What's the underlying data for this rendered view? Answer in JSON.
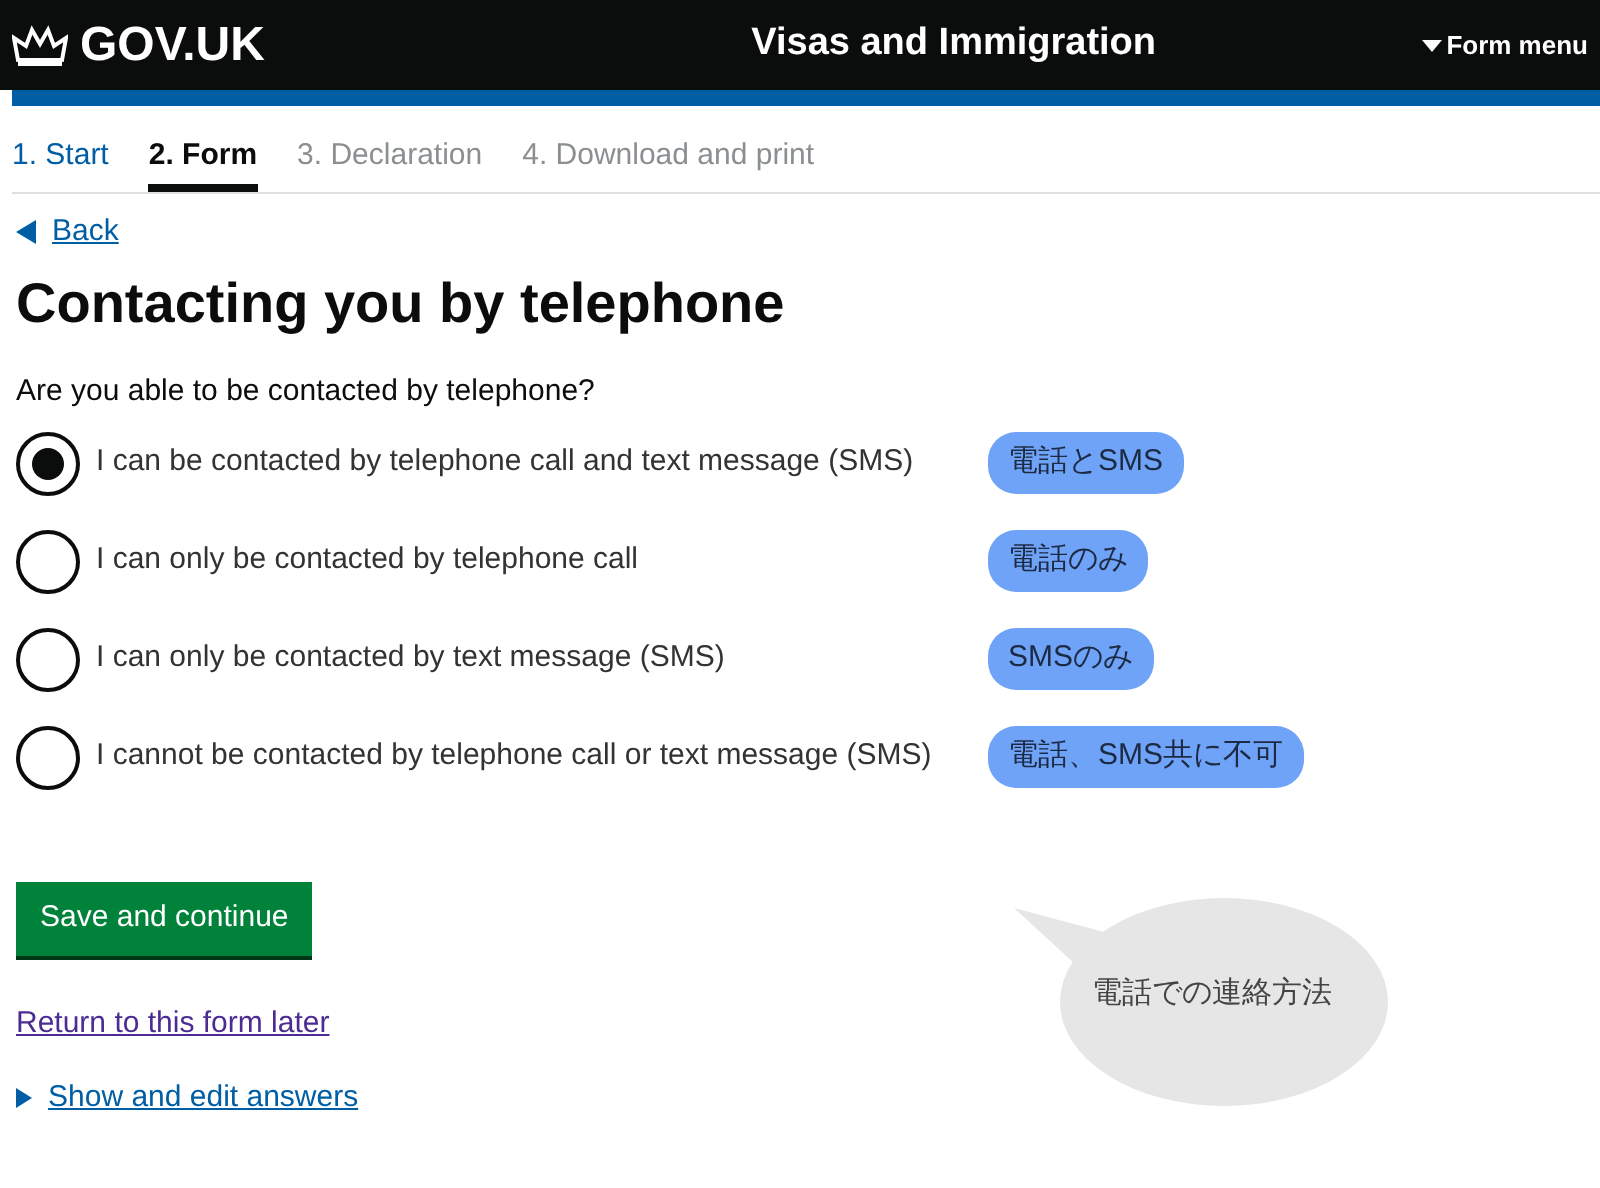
{
  "header": {
    "logo": "GOV.UK",
    "title": "Visas and Immigration",
    "menu": "Form menu"
  },
  "steps": [
    {
      "label": "1. Start",
      "selected": false,
      "disabled": false
    },
    {
      "label": "2. Form",
      "selected": true,
      "disabled": false
    },
    {
      "label": "3. Declaration",
      "selected": false,
      "disabled": true
    },
    {
      "label": "4. Download and print",
      "selected": false,
      "disabled": true
    }
  ],
  "back_link": "Back",
  "heading": "Contacting you by telephone",
  "question": "Are you able to be contacted by telephone?",
  "options": [
    {
      "label": "I can be contacted by telephone call and text message (SMS)",
      "selected": true,
      "note": "電話とSMS"
    },
    {
      "label": "I can only be contacted by telephone call",
      "selected": false,
      "note": "電話のみ"
    },
    {
      "label": "I can only be contacted by text message (SMS)",
      "selected": false,
      "note": "SMSのみ"
    },
    {
      "label": "I cannot be contacted by telephone call or text message (SMS)",
      "selected": false,
      "note": "電話、SMS共に不可"
    }
  ],
  "save_button": "Save and continue",
  "return_link": "Return to this form later",
  "details_link": "Show and edit answers",
  "callout": "電話での連絡方法"
}
